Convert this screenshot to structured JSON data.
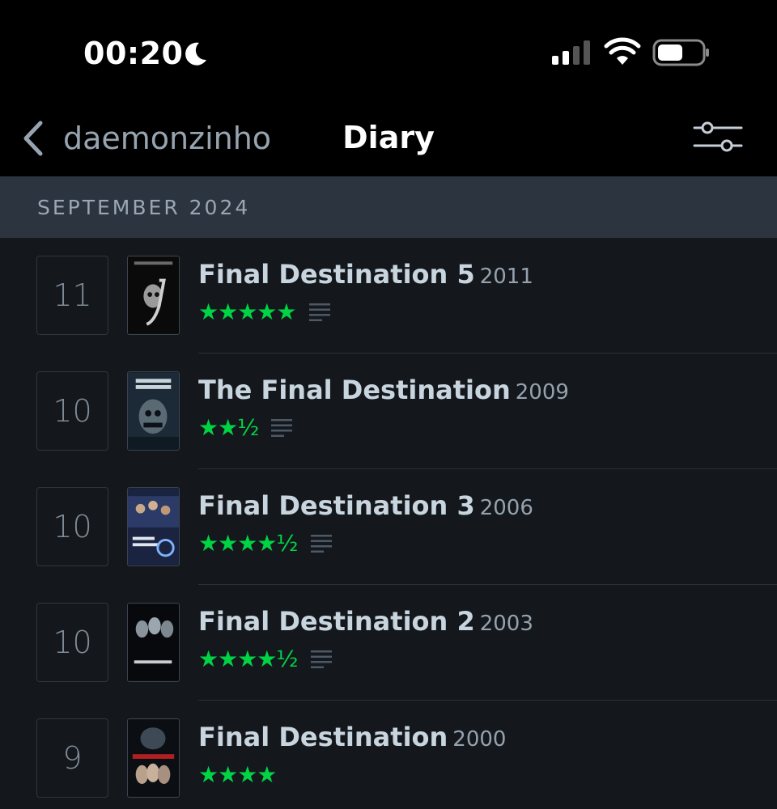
{
  "status_bar": {
    "time": "00:20",
    "focus_icon": "moon-icon",
    "signal_icon": "cellular-signal-icon",
    "wifi_icon": "wifi-icon",
    "battery_icon": "battery-icon"
  },
  "nav": {
    "back_label": "daemonzinho",
    "title": "Diary",
    "filter_icon": "sliders-icon"
  },
  "section": {
    "label": "SEPTEMBER 2024"
  },
  "colors": {
    "accent_green": "#00d445",
    "background": "#14181c",
    "section_bg": "#2c3440"
  },
  "entries": [
    {
      "day": "11",
      "title": "Final Destination 5",
      "year": "2011",
      "rating": "★★★★★",
      "has_review": true
    },
    {
      "day": "10",
      "title": "The Final Destination",
      "year": "2009",
      "rating": "★★½",
      "has_review": true
    },
    {
      "day": "10",
      "title": "Final Destination 3",
      "year": "2006",
      "rating": "★★★★½",
      "has_review": true
    },
    {
      "day": "10",
      "title": "Final Destination 2",
      "year": "2003",
      "rating": "★★★★½",
      "has_review": true
    },
    {
      "day": "9",
      "title": "Final Destination",
      "year": "2000",
      "rating": "★★★★",
      "has_review": false
    }
  ]
}
